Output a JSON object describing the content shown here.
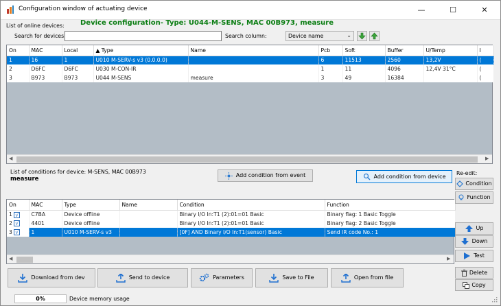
{
  "window": {
    "title": "Configuration window of actuating device",
    "minimize_glyph": "—",
    "maximize_glyph": "☐",
    "close_glyph": "✕"
  },
  "header": {
    "online_devices_label": "List of online devices:",
    "device_configuration": "Device configuration- Type: U044-M-SENS, MAC 00B973, measure"
  },
  "search": {
    "label": "Search for devices:",
    "value": "",
    "column_label": "Search column:",
    "column_value": "Device name"
  },
  "devices_table": {
    "columns": [
      "On",
      "MAC",
      "Local",
      "▲ Type",
      "Name",
      "Pcb",
      "Soft",
      "Buffer",
      "U/Temp",
      "I"
    ],
    "rows": [
      [
        "1",
        "16",
        "1",
        "U010 M-SERV-s v3 (0.0.0.0)",
        "",
        "6",
        "11513",
        "2560",
        "13,2V",
        "("
      ],
      [
        "2",
        "D6FC",
        "D6FC",
        "U030 M-CON-IR",
        "",
        "1",
        "11",
        "4096",
        "12,4V 31°C",
        "("
      ],
      [
        "3",
        "B973",
        "B973",
        "U044 M-SENS",
        "measure",
        "3",
        "49",
        "16384",
        "",
        "("
      ]
    ],
    "selected_row": 0
  },
  "conditions": {
    "list_label": "List of conditions for device: M-SENS, MAC 00B973",
    "device_name": "measure",
    "add_from_event": "Add condition from event",
    "add_from_device": "Add condition from device",
    "re_edit_label": "Re-edit:",
    "columns": [
      "On",
      "MAC",
      "Type",
      "Name",
      "Condition",
      "Function"
    ],
    "rows": [
      [
        "1",
        "C7BA",
        "Device offline",
        "",
        "Binary I/O In:T1  (2):01=01  Basic",
        "Binary flag:  1  Basic Toggle"
      ],
      [
        "2",
        "4401",
        "Device offline",
        "",
        "Binary I/O In:T1  (2):01=01  Basic",
        "Binary flag:  2  Basic Toggle"
      ],
      [
        "3",
        "1",
        "U010 M-SERV-s v3",
        "",
        "[0F] AND  Binary I/O In:T1(sensor)  Basic",
        "Send IR code No.: 1"
      ]
    ],
    "checked": "√",
    "selected_row": 2
  },
  "side_buttons": {
    "condition": "Condition",
    "function": "Function",
    "up": "Up",
    "down": "Down",
    "test": "Test",
    "delete": "Delete",
    "copy": "Copy"
  },
  "bottom_buttons": {
    "download": "Download from dev",
    "send": "Send to device",
    "parameters": "Parameters",
    "save": "Save to File",
    "open": "Open from file"
  },
  "status": {
    "progress_text": "0%",
    "progress_value": 0,
    "memory_label": "Device memory usage"
  },
  "colors": {
    "selection": "#0078d7",
    "heading_green": "#0a7d12",
    "grid_empty": "#b3bdc6"
  }
}
